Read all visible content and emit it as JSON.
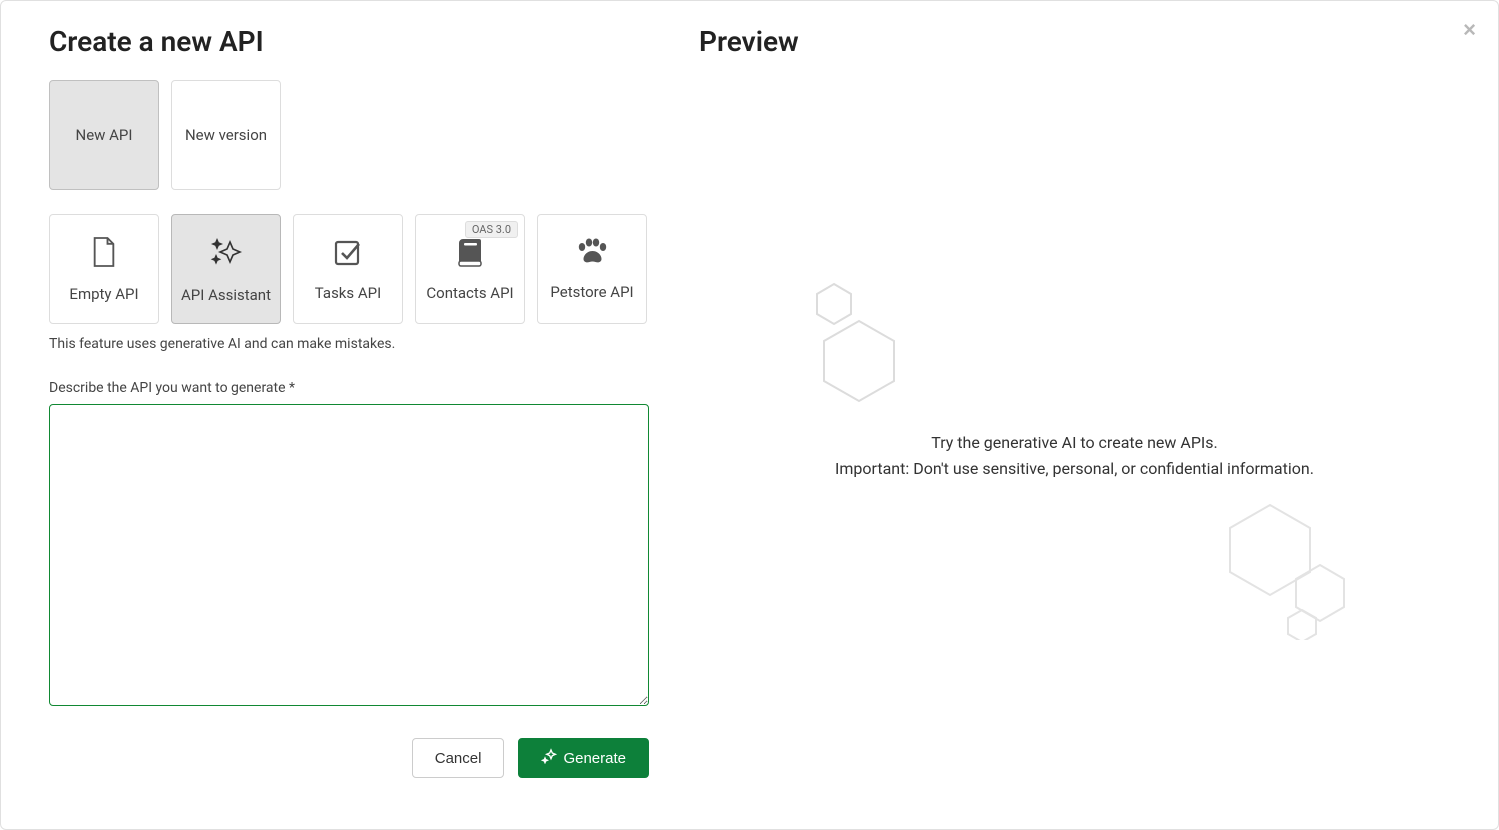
{
  "leftTitle": "Create a new API",
  "rightTitle": "Preview",
  "modeTabs": {
    "newApi": "New API",
    "newVersion": "New version"
  },
  "templates": {
    "emptyApi": "Empty API",
    "apiAssistant": "API Assistant",
    "tasksApi": "Tasks API",
    "contactsApi": "Contacts API",
    "contactsBadge": "OAS 3.0",
    "petstoreApi": "Petstore API"
  },
  "aiHint": "This feature uses generative AI and can make mistakes.",
  "describeLabel": "Describe the API you want to generate *",
  "describeValue": "",
  "buttons": {
    "cancel": "Cancel",
    "generate": "Generate"
  },
  "preview": {
    "line1": "Try the generative AI to create new APIs.",
    "line2": "Important: Don't use sensitive, personal, or confidential information."
  }
}
